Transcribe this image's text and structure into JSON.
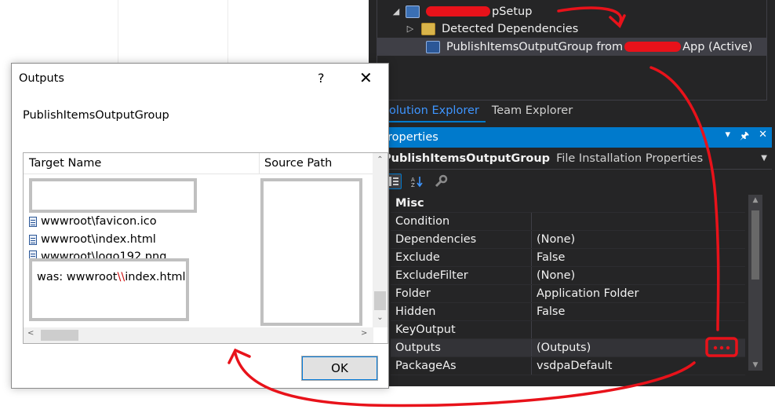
{
  "solution_tree": {
    "items": [
      {
        "label": "pSetup",
        "arrow": "◢"
      },
      {
        "label": "Detected Dependencies",
        "arrow": "▷"
      },
      {
        "label_before": "PublishItemsOutputGroup from ",
        "label_after": "App (Active)"
      }
    ]
  },
  "tabs": [
    {
      "label": "olution Explorer"
    },
    {
      "label": "Team Explorer"
    }
  ],
  "properties": {
    "title": "roperties",
    "title_buttons": [
      "▾",
      "🖈",
      "✕"
    ],
    "object_name": "PublishItemsOutputGroup",
    "object_type": "File Installation Properties",
    "category": "Misc",
    "rows": [
      {
        "name": "Condition",
        "value": ""
      },
      {
        "name": "Dependencies",
        "value": "(None)"
      },
      {
        "name": "Exclude",
        "value": "False"
      },
      {
        "name": "ExcludeFilter",
        "value": "(None)"
      },
      {
        "name": "Folder",
        "value": "Application Folder"
      },
      {
        "name": "Hidden",
        "value": "False"
      },
      {
        "name": "KeyOutput",
        "value": ""
      },
      {
        "name": "Outputs",
        "value": "(Outputs)"
      },
      {
        "name": "PackageAs",
        "value": "vsdpaDefault"
      }
    ]
  },
  "dialog": {
    "title": "Outputs",
    "help_glyph": "?",
    "close_glyph": "✕",
    "group_label": "PublishItemsOutputGroup",
    "columns": [
      "Target Name",
      "Source Path"
    ],
    "items": [
      "wwwroot\\favicon.ico",
      "wwwroot\\index.html",
      "wwwroot\\logo192.png"
    ],
    "annotation": {
      "prefix": "was: wwwroot",
      "slashes": "\\\\",
      "suffix": "index.html"
    },
    "ok_label": "OK"
  },
  "colors": {
    "vs_background": "#252526",
    "accent_blue": "#007acc",
    "annotation_red": "#e8121a"
  },
  "icons": [
    "setup-project-icon",
    "folder-icon",
    "output-group-icon",
    "file-icon",
    "categorized-icon",
    "alphabetical-icon",
    "property-pages-icon"
  ]
}
